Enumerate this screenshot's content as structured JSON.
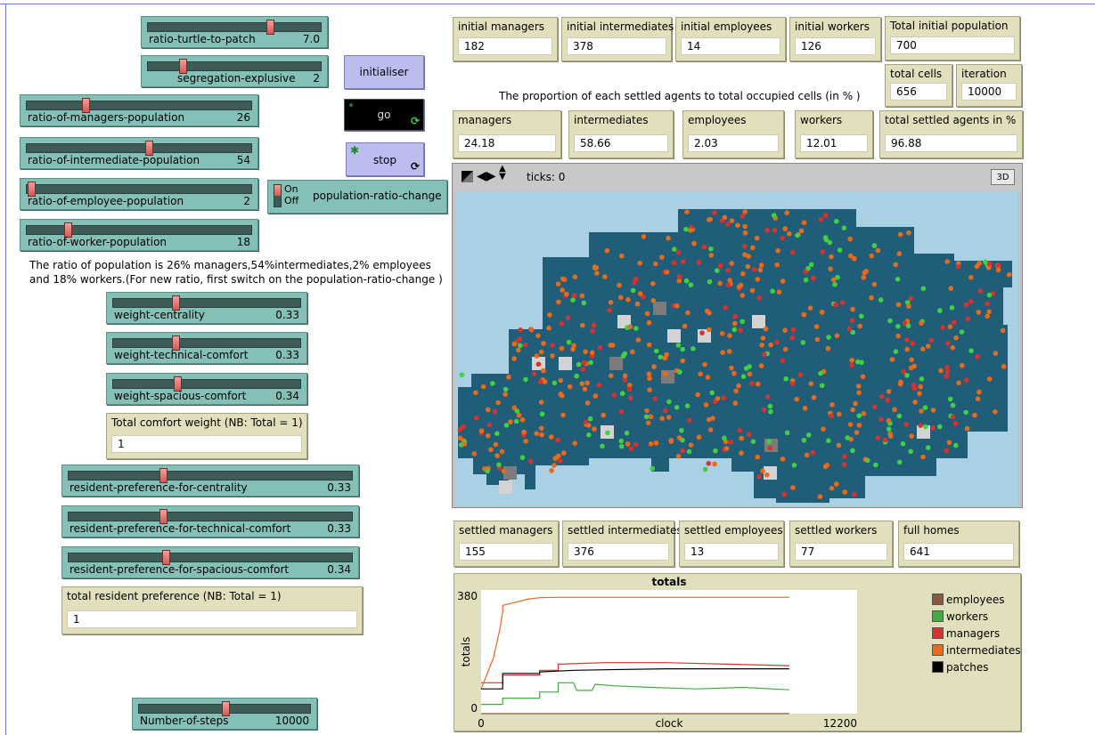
{
  "sliders": {
    "turtle_to_patch": {
      "label": "ratio-turtle-to-patch",
      "value": "7.0",
      "fraction": 0.7
    },
    "segregation": {
      "label": "segregation-explusive",
      "value": "2",
      "fraction": 0.2
    },
    "managers": {
      "label": "ratio-of-managers-population",
      "value": "26",
      "fraction": 0.26
    },
    "intermediate": {
      "label": "ratio-of-intermediate-population",
      "value": "54",
      "fraction": 0.54
    },
    "employee": {
      "label": "ratio-of-employee-population",
      "value": "2",
      "fraction": 0.02
    },
    "worker": {
      "label": "ratio-of-worker-population",
      "value": "18",
      "fraction": 0.18
    },
    "w_centrality": {
      "label": "weight-centrality",
      "value": "0.33",
      "fraction": 0.33
    },
    "w_technical": {
      "label": "weight-technical-comfort",
      "value": "0.33",
      "fraction": 0.33
    },
    "w_spacious": {
      "label": "weight-spacious-comfort",
      "value": "0.34",
      "fraction": 0.34
    },
    "p_centrality": {
      "label": "resident-preference-for-centrality",
      "value": "0.33",
      "fraction": 0.33
    },
    "p_technical": {
      "label": "resident-preference-for-technical-comfort",
      "value": "0.33",
      "fraction": 0.33
    },
    "p_spacious": {
      "label": "resident-preference-for-spacious-comfort",
      "value": "0.34",
      "fraction": 0.34
    },
    "steps": {
      "label": "Number-of-steps",
      "value": "10000",
      "fraction": 0.5
    }
  },
  "buttons": {
    "initialiser": "initialiser",
    "go": "go",
    "stop": "stop"
  },
  "switch": {
    "on": "On",
    "off": "Off",
    "label": "population-ratio-change"
  },
  "notes": {
    "ratio_line1": "The ratio of population is 26% managers,54%intermediates,2% employees",
    "ratio_line2": "and 18% workers.(For new ratio, first switch on the population-ratio-change )",
    "proportion": "The proportion of each settled agents to total occupied cells (in % )"
  },
  "monitors": {
    "total_comfort": {
      "label": "Total comfort weight (NB: Total = 1)",
      "value": "1"
    },
    "total_pref": {
      "label": "total resident preference (NB: Total = 1)",
      "value": "1"
    },
    "init_managers": {
      "label": "initial managers",
      "value": "182"
    },
    "init_intermediates": {
      "label": "initial intermediates",
      "value": "378"
    },
    "init_employees": {
      "label": "initial employees",
      "value": "14"
    },
    "init_workers": {
      "label": "initial workers",
      "value": "126"
    },
    "total_init_pop": {
      "label": "Total initial population",
      "value": "700"
    },
    "total_cells": {
      "label": "total cells",
      "value": "656"
    },
    "iteration": {
      "label": "iteration",
      "value": "10000"
    },
    "pct_managers": {
      "label": "managers",
      "value": "24.18"
    },
    "pct_intermediates": {
      "label": "intermediates",
      "value": "58.66"
    },
    "pct_employees": {
      "label": "employees",
      "value": "2.03"
    },
    "pct_workers": {
      "label": "workers",
      "value": "12.01"
    },
    "pct_total": {
      "label": "total settled agents in %",
      "value": "96.88"
    },
    "settled_managers": {
      "label": "settled managers",
      "value": "155"
    },
    "settled_intermediates": {
      "label": "settled intermediates",
      "value": "376"
    },
    "settled_employees": {
      "label": "settled employees",
      "value": "13"
    },
    "settled_workers": {
      "label": "settled workers",
      "value": "77"
    },
    "full_homes": {
      "label": "full homes",
      "value": "641"
    }
  },
  "view": {
    "ticks": "ticks: 0",
    "btn3d": "3D",
    "colors": {
      "water": "#a9d0e3",
      "land": "#1f5d79",
      "gray_light": "#d3d3d3",
      "gray_dark": "#7c7c7c",
      "orange": "#ea6a1a",
      "red": "#d8322e",
      "green": "#3fd13f",
      "brown": "#8a5a42"
    }
  },
  "chart_data": {
    "type": "line",
    "title": "totals",
    "xlabel": "clock",
    "ylabel": "totals",
    "xlim": [
      0,
      12200
    ],
    "ylim": [
      0,
      400
    ],
    "x_ticks": [
      "0",
      "12200"
    ],
    "y_ticks": [
      "0",
      "380"
    ],
    "series": [
      {
        "name": "employees",
        "color": "#8b5a3c",
        "x": [
          0,
          700,
          10000
        ],
        "y": [
          0,
          0,
          0
        ]
      },
      {
        "name": "workers",
        "color": "#3fae3f",
        "x": [
          0,
          700,
          700,
          1900,
          1900,
          2500,
          2500,
          3000,
          3100,
          3600,
          3700,
          4300,
          5500,
          7000,
          8500,
          10000
        ],
        "y": [
          30,
          30,
          50,
          50,
          70,
          70,
          100,
          100,
          75,
          75,
          95,
          90,
          85,
          80,
          85,
          77
        ]
      },
      {
        "name": "managers",
        "color": "#d8322e",
        "x": [
          0,
          700,
          700,
          1900,
          1900,
          2500,
          2500,
          4000,
          6000,
          8000,
          10000
        ],
        "y": [
          100,
          100,
          125,
          125,
          140,
          140,
          160,
          165,
          165,
          160,
          155
        ]
      },
      {
        "name": "intermediates",
        "color": "#ec6a1a",
        "x": [
          0,
          400,
          600,
          700,
          700,
          1100,
          1500,
          1900,
          2500,
          3500,
          10000
        ],
        "y": [
          80,
          180,
          270,
          330,
          350,
          360,
          370,
          375,
          376,
          376,
          376
        ]
      },
      {
        "name": "patches",
        "color": "#000000",
        "x": [
          0,
          700,
          700,
          1900,
          1900,
          3000,
          4000,
          6000,
          8000,
          10000
        ],
        "y": [
          80,
          80,
          130,
          130,
          135,
          140,
          142,
          145,
          145,
          145
        ]
      }
    ]
  }
}
